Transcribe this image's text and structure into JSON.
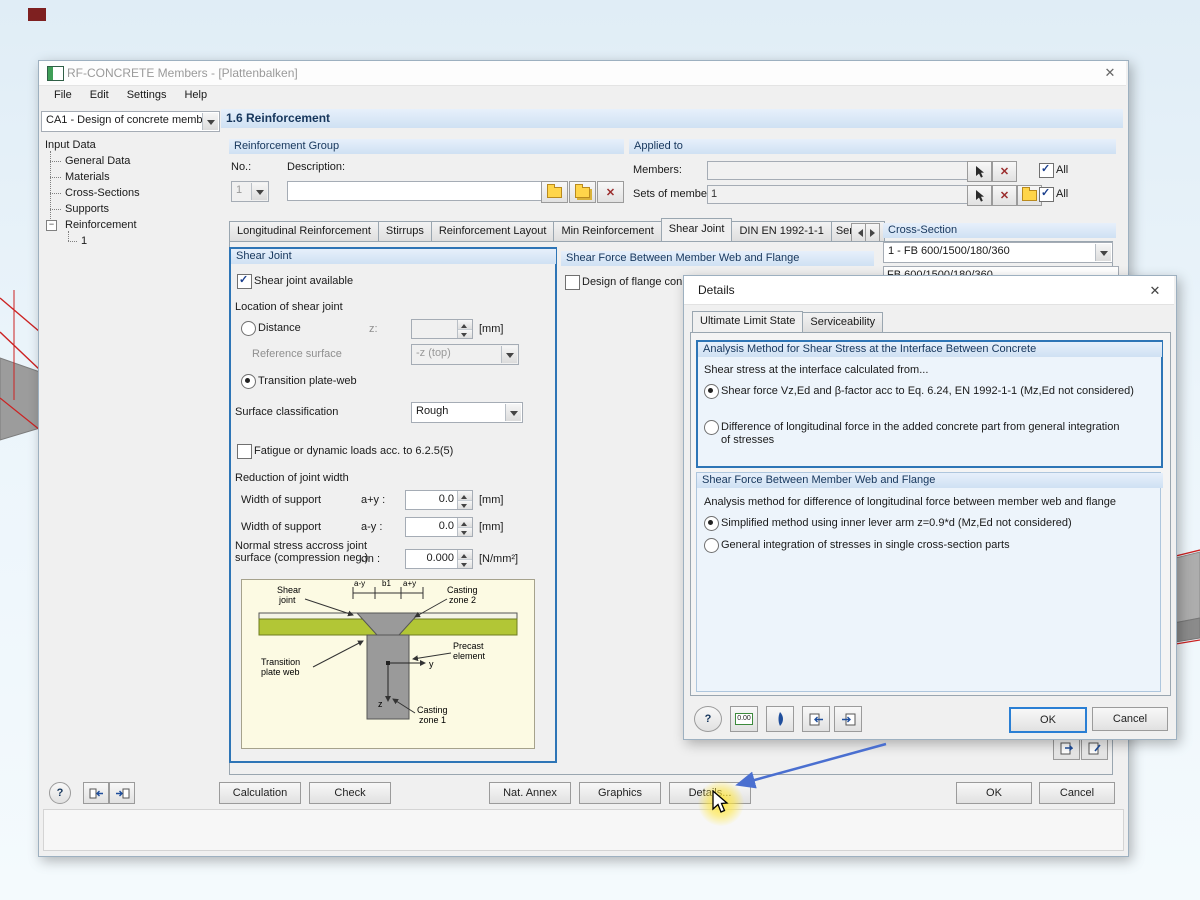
{
  "window": {
    "title": "RF-CONCRETE Members - [Plattenbalken]",
    "menu": [
      "File",
      "Edit",
      "Settings",
      "Help"
    ],
    "section_header": "1.6 Reinforcement",
    "close_glyph": "✕"
  },
  "sidebar": {
    "case_value": "CA1 - Design of concrete memb",
    "root": "Input Data",
    "items": [
      "General Data",
      "Materials",
      "Cross-Sections",
      "Supports",
      "Reinforcement"
    ],
    "child": "1"
  },
  "group_section": {
    "header": "Reinforcement Group",
    "no_label": "No.:",
    "no_value": "1",
    "desc_label": "Description:",
    "desc_value": ""
  },
  "applied": {
    "header": "Applied to",
    "members_label": "Members:",
    "members_value": "",
    "sets_label": "Sets of members:",
    "sets_value": "1",
    "all1": "All",
    "all2": "All"
  },
  "tabs": [
    "Longitudinal Reinforcement",
    "Stirrups",
    "Reinforcement Layout",
    "Min Reinforcement",
    "Shear Joint",
    "DIN EN 1992-1-1",
    "Service"
  ],
  "shear_joint": {
    "header": "Shear Joint",
    "available": "Shear joint available",
    "location": "Location of shear joint",
    "distance": "Distance",
    "z_label": "z:",
    "z_value": "",
    "z_unit": "[mm]",
    "ref_label": "Reference surface",
    "ref_value": "-z (top)",
    "transition": "Transition plate-web",
    "surface_label": "Surface classification",
    "surface_value": "Rough",
    "fatigue": "Fatigue or dynamic loads acc. to 6.2.5(5)",
    "reduction": "Reduction of joint width",
    "w1_label": "Width of support",
    "w1_sym": "a+y :",
    "w1_value": "0.0",
    "w1_unit": "[mm]",
    "w2_label": "Width of support",
    "w2_sym": "a-y :",
    "w2_value": "0.0",
    "w2_unit": "[mm]",
    "n_label1": "Normal stress accross joint",
    "n_label2": "surface (compression neg.)",
    "n_sym": "σn :",
    "n_value": "0.000",
    "n_unit": "[N/mm²]",
    "diagram": {
      "shear1": "Shear",
      "shear2": "joint",
      "dim1": "a-y",
      "dim2": "b1",
      "dim3": "a+y",
      "cast2a": "Casting",
      "cast2b": "zone 2",
      "trans1": "Transition",
      "trans2": "plate web",
      "precast1": "Precast",
      "precast2": "element",
      "cast1a": "Casting",
      "cast1b": "zone 1",
      "axis_z": "z",
      "axis_y": "y"
    }
  },
  "shear_force": {
    "header": "Shear Force Between Member Web and Flange",
    "checkbox": "Design of flange conne"
  },
  "cross_section": {
    "header": "Cross-Section",
    "value": "1 - FB 600/1500/180/360",
    "list_item": "FB 600/1500/180/360"
  },
  "footer": {
    "help": "?",
    "calculation": "Calculation",
    "check": "Check",
    "nat_annex": "Nat. Annex",
    "graphics": "Graphics",
    "details": "Details...",
    "ok": "OK",
    "cancel": "Cancel"
  },
  "details": {
    "title": "Details",
    "close_glyph": "✕",
    "tab_uls": "Ultimate Limit State",
    "tab_sls": "Serviceability",
    "g1_header": "Analysis Method for Shear Stress at the Interface Between Concrete",
    "g1_intro": "Shear stress at the interface calculated from...",
    "g1_radio1": "Shear force Vz,Ed and β-factor acc to Eq. 6.24, EN 1992-1-1 (Mz,Ed not considered)",
    "g1_radio2": "Difference of longitudinal force in the added concrete part from general integration of stresses",
    "g2_header": "Shear Force Between Member Web and Flange",
    "g2_intro": "Analysis method for difference of longitudinal force between member web and flange",
    "g2_radio1": "Simplified method using inner lever arm z=0.9*d (Mz,Ed not considered)",
    "g2_radio2": "General integration of stresses in single cross-section parts",
    "help": "?",
    "calc_icon": "0.00",
    "ok": "OK",
    "cancel": "Cancel"
  }
}
